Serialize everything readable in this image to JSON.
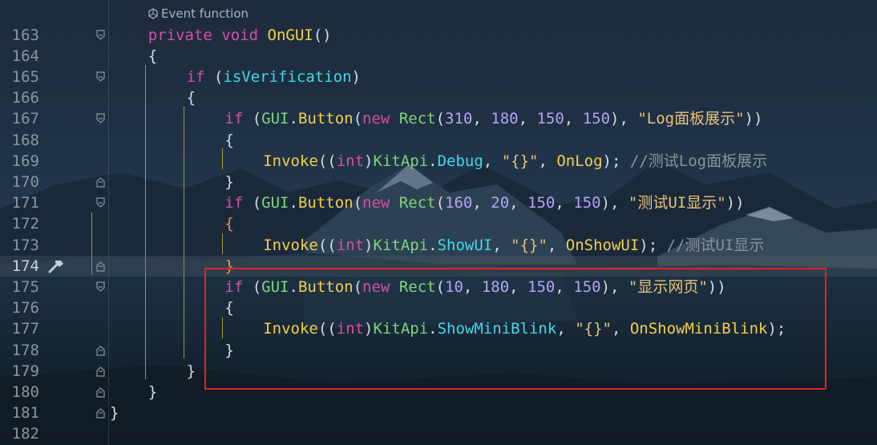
{
  "hint": {
    "icon": "unity-event-icon",
    "label": "Event function"
  },
  "current_line": 174,
  "lines": [
    {
      "no": "163",
      "fold": "down",
      "indent": 4,
      "tokens": [
        [
          "kw",
          "private "
        ],
        [
          "kw",
          "void "
        ],
        [
          "method",
          "OnGUI"
        ],
        [
          "plain",
          "()"
        ]
      ]
    },
    {
      "no": "164",
      "fold": "",
      "indent": 4,
      "tokens": [
        [
          "plain",
          "{"
        ]
      ]
    },
    {
      "no": "165",
      "fold": "down",
      "indent": 8,
      "tokens": [
        [
          "kw",
          "if"
        ],
        [
          "plain",
          " ("
        ],
        [
          "field",
          "isVerification"
        ],
        [
          "plain",
          ")"
        ]
      ]
    },
    {
      "no": "166",
      "fold": "",
      "indent": 8,
      "tokens": [
        [
          "plain",
          "{"
        ]
      ]
    },
    {
      "no": "167",
      "fold": "down",
      "indent": 12,
      "tokens": [
        [
          "kw",
          "if"
        ],
        [
          "plain",
          " ("
        ],
        [
          "type",
          "GUI"
        ],
        [
          "plain",
          "."
        ],
        [
          "method",
          "Button"
        ],
        [
          "plain",
          "("
        ],
        [
          "kw",
          "new "
        ],
        [
          "type",
          "Rect"
        ],
        [
          "plain",
          "("
        ],
        [
          "num",
          "310"
        ],
        [
          "plain",
          ", "
        ],
        [
          "num",
          "180"
        ],
        [
          "plain",
          ", "
        ],
        [
          "num",
          "150"
        ],
        [
          "plain",
          ", "
        ],
        [
          "num",
          "150"
        ],
        [
          "plain",
          "), "
        ],
        [
          "str",
          "\"Log面板展示\""
        ],
        [
          "plain",
          "))"
        ]
      ]
    },
    {
      "no": "168",
      "fold": "",
      "indent": 12,
      "tokens": [
        [
          "plain",
          "{"
        ]
      ]
    },
    {
      "no": "169",
      "fold": "",
      "indent": 16,
      "tokens": [
        [
          "method",
          "Invoke"
        ],
        [
          "plain",
          "(("
        ],
        [
          "kw",
          "int"
        ],
        [
          "plain",
          ")"
        ],
        [
          "type",
          "KitApi"
        ],
        [
          "plain",
          "."
        ],
        [
          "field",
          "Debug"
        ],
        [
          "plain",
          ", "
        ],
        [
          "str",
          "\"{}\""
        ],
        [
          "plain",
          ", "
        ],
        [
          "method",
          "OnLog"
        ],
        [
          "plain",
          ");"
        ],
        [
          "cmt",
          " //测试Log面板展示"
        ]
      ]
    },
    {
      "no": "170",
      "fold": "up",
      "indent": 12,
      "tokens": [
        [
          "plain",
          "}"
        ]
      ]
    },
    {
      "no": "171",
      "fold": "down",
      "indent": 12,
      "tokens": [
        [
          "kw",
          "if"
        ],
        [
          "plain",
          " ("
        ],
        [
          "type",
          "GUI"
        ],
        [
          "plain",
          "."
        ],
        [
          "method",
          "Button"
        ],
        [
          "plain",
          "("
        ],
        [
          "kw",
          "new "
        ],
        [
          "type",
          "Rect"
        ],
        [
          "plain",
          "("
        ],
        [
          "num",
          "160"
        ],
        [
          "plain",
          ", "
        ],
        [
          "num",
          "20"
        ],
        [
          "plain",
          ", "
        ],
        [
          "num",
          "150"
        ],
        [
          "plain",
          ", "
        ],
        [
          "num",
          "150"
        ],
        [
          "plain",
          "), "
        ],
        [
          "str",
          "\"测试UI显示\""
        ],
        [
          "plain",
          "))"
        ]
      ]
    },
    {
      "no": "172",
      "fold": "",
      "indent": 12,
      "tokens": [
        [
          "orange",
          "{"
        ]
      ]
    },
    {
      "no": "173",
      "fold": "",
      "indent": 16,
      "tokens": [
        [
          "method",
          "Invoke"
        ],
        [
          "plain",
          "(("
        ],
        [
          "kw",
          "int"
        ],
        [
          "plain",
          ")"
        ],
        [
          "type",
          "KitApi"
        ],
        [
          "plain",
          "."
        ],
        [
          "field",
          "ShowUI"
        ],
        [
          "plain",
          ", "
        ],
        [
          "str",
          "\"{}\""
        ],
        [
          "plain",
          ", "
        ],
        [
          "method",
          "OnShowUI"
        ],
        [
          "plain",
          ");"
        ],
        [
          "cmt",
          " //测试UI显示"
        ]
      ]
    },
    {
      "no": "174",
      "fold": "up",
      "indent": 12,
      "tokens": [
        [
          "orange",
          "}"
        ]
      ]
    },
    {
      "no": "175",
      "fold": "down",
      "indent": 12,
      "tokens": [
        [
          "kw",
          "if"
        ],
        [
          "plain",
          " ("
        ],
        [
          "type",
          "GUI"
        ],
        [
          "plain",
          "."
        ],
        [
          "method",
          "Button"
        ],
        [
          "plain",
          "("
        ],
        [
          "kw",
          "new "
        ],
        [
          "type",
          "Rect"
        ],
        [
          "plain",
          "("
        ],
        [
          "num",
          "10"
        ],
        [
          "plain",
          ", "
        ],
        [
          "num",
          "180"
        ],
        [
          "plain",
          ", "
        ],
        [
          "num",
          "150"
        ],
        [
          "plain",
          ", "
        ],
        [
          "num",
          "150"
        ],
        [
          "plain",
          "), "
        ],
        [
          "str",
          "\"显示网页\""
        ],
        [
          "plain",
          "))"
        ]
      ]
    },
    {
      "no": "176",
      "fold": "",
      "indent": 12,
      "tokens": [
        [
          "plain",
          "{"
        ]
      ]
    },
    {
      "no": "177",
      "fold": "",
      "indent": 16,
      "tokens": [
        [
          "method",
          "Invoke"
        ],
        [
          "plain",
          "(("
        ],
        [
          "kw",
          "int"
        ],
        [
          "plain",
          ")"
        ],
        [
          "type",
          "KitApi"
        ],
        [
          "plain",
          "."
        ],
        [
          "field",
          "ShowMiniBlink"
        ],
        [
          "plain",
          ", "
        ],
        [
          "str",
          "\"{}\""
        ],
        [
          "plain",
          ", "
        ],
        [
          "method",
          "OnShowMiniBlink"
        ],
        [
          "plain",
          ");"
        ]
      ]
    },
    {
      "no": "178",
      "fold": "up",
      "indent": 12,
      "tokens": [
        [
          "plain",
          "}"
        ]
      ]
    },
    {
      "no": "179",
      "fold": "up",
      "indent": 8,
      "tokens": [
        [
          "plain",
          "}"
        ]
      ]
    },
    {
      "no": "180",
      "fold": "up",
      "indent": 4,
      "tokens": [
        [
          "plain",
          "}"
        ]
      ]
    },
    {
      "no": "181",
      "fold": "up",
      "indent": 0,
      "tokens": [
        [
          "plain",
          "}"
        ]
      ]
    },
    {
      "no": "182",
      "fold": "",
      "indent": 0,
      "tokens": []
    }
  ]
}
